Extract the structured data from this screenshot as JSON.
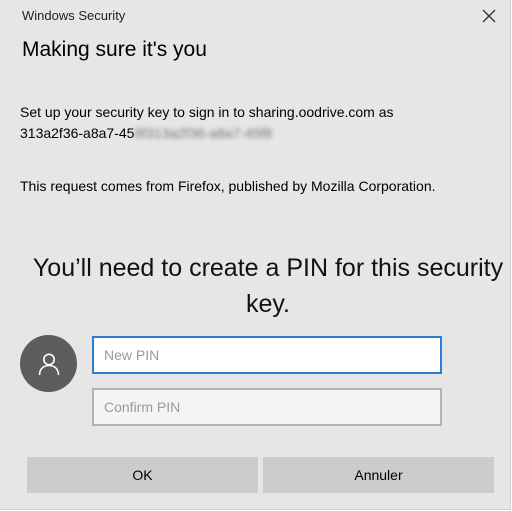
{
  "window": {
    "app_title": "Windows Security",
    "close_icon": "close-icon"
  },
  "dialog": {
    "heading": "Making sure it's you",
    "setup_text_line1": "Set up your security key to sign in to sharing.oodrive.com as",
    "setup_text_id_visible": "313a2f36-a8a7-45",
    "setup_text_id_blurred": "8f313a2f36-a8a7-45f8",
    "request_text": "This request comes from Firefox, published by Mozilla Corporation.",
    "pin_prompt": "You’ll need to create a PIN for this security key."
  },
  "form": {
    "avatar_icon": "user-icon",
    "new_pin_placeholder": "New PIN",
    "new_pin_value": "",
    "confirm_pin_placeholder": "Confirm PIN",
    "confirm_pin_value": ""
  },
  "buttons": {
    "ok_label": "OK",
    "cancel_label": "Annuler"
  },
  "colors": {
    "dialog_background": "#e6e6e6",
    "focus_border": "#2a7fd4",
    "button_background": "#cccccc",
    "avatar_background": "#5d5d5d"
  }
}
